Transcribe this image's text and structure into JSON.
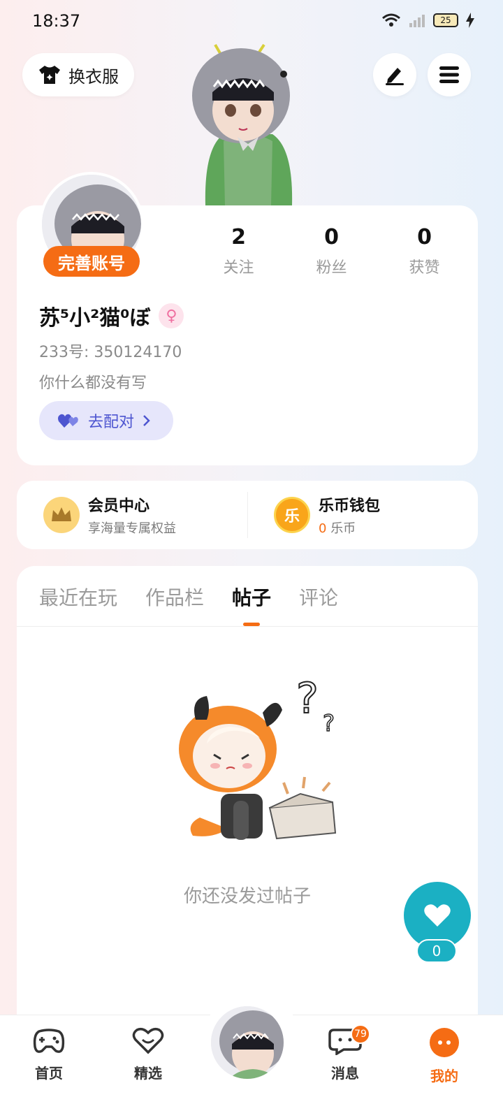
{
  "status_bar": {
    "time": "18:37",
    "battery": "25"
  },
  "top": {
    "outfit_label": "换衣服"
  },
  "profile": {
    "complete_badge": "完善账号",
    "stats": [
      {
        "value": "2",
        "label": "关注"
      },
      {
        "value": "0",
        "label": "粉丝"
      },
      {
        "value": "0",
        "label": "获赞"
      }
    ],
    "username": "苏⁵小²猫⁰ぼ",
    "gender_symbol": "♀",
    "uid_label": "233号:",
    "uid": "350124170",
    "bio": "你什么都没有写",
    "match_label": "去配对"
  },
  "member": {
    "title": "会员中心",
    "subtitle": "享海量专属权益"
  },
  "wallet": {
    "title": "乐币钱包",
    "coin_amount": "0",
    "coin_unit": "乐币",
    "icon_char": "乐"
  },
  "tabs": [
    {
      "label": "最近在玩",
      "active": false
    },
    {
      "label": "作品栏",
      "active": false
    },
    {
      "label": "帖子",
      "active": true
    },
    {
      "label": "评论",
      "active": false
    }
  ],
  "empty_state": {
    "text": "你还没发过帖子"
  },
  "like": {
    "count": "0"
  },
  "bottom_nav": {
    "home": "首页",
    "featured": "精选",
    "messages": "消息",
    "messages_badge": "79",
    "mine": "我的"
  },
  "colors": {
    "accent": "#f56c14",
    "like": "#1bb0c3",
    "match": "#4d55d0"
  }
}
